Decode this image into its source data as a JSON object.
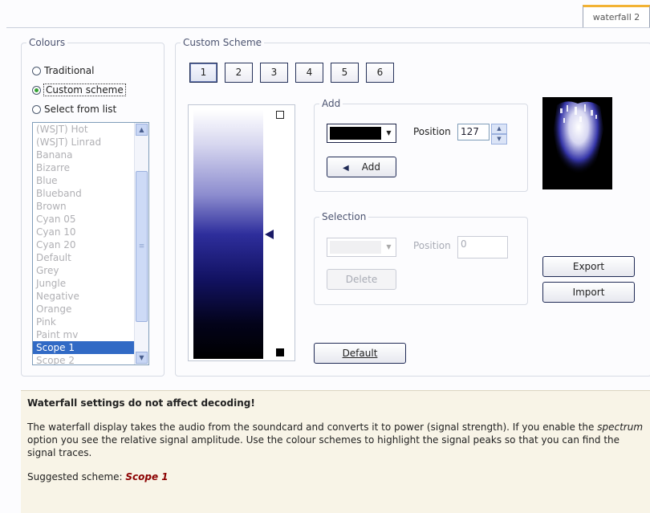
{
  "tab": {
    "label": "waterfall 2"
  },
  "colours": {
    "legend": "Colours",
    "radios": [
      {
        "label": "Traditional",
        "selected": false
      },
      {
        "label": "Custom scheme",
        "selected": true
      },
      {
        "label": "Select from list",
        "selected": false
      }
    ],
    "list": [
      "(WSJT) Hot",
      "(WSJT) Linrad",
      "Banana",
      "Bizarre",
      "Blue",
      "Blueband",
      "Brown",
      "Cyan 05",
      "Cyan 10",
      "Cyan 20",
      "Default",
      "Grey",
      "Jungle",
      "Negative",
      "Orange",
      "Pink",
      "Paint mv",
      "Scope 1",
      "Scope 2"
    ],
    "selected_item": "Scope 1"
  },
  "custom_scheme": {
    "legend": "Custom Scheme",
    "number_buttons": [
      "1",
      "2",
      "3",
      "4",
      "5",
      "6"
    ],
    "active_number": "1",
    "add": {
      "legend": "Add",
      "colour": "#000000",
      "position_label": "Position",
      "position_value": "127",
      "button": "Add"
    },
    "selection": {
      "legend": "Selection",
      "position_label": "Position",
      "position_value": "0",
      "button": "Delete"
    },
    "default_button": "Default",
    "export_button": "Export",
    "import_button": "Import"
  },
  "info": {
    "heading": "Waterfall settings do not affect decoding!",
    "body_part1": "The waterfall display takes the audio from the soundcard and converts it to power (signal strength). If you enable the ",
    "body_emph": "spectrum",
    "body_part2": " option you see the relative signal amplitude. Use the colour schemes to highlight the signal peaks so that you can find the signal traces.",
    "suggested_label": "Suggested scheme: ",
    "suggested_value": "Scope 1"
  },
  "colors": {
    "accent": "#316ac5",
    "tab_highlight": "#f2b233",
    "suggested_text": "#8b0000",
    "info_bg": "#f8f4e7"
  }
}
